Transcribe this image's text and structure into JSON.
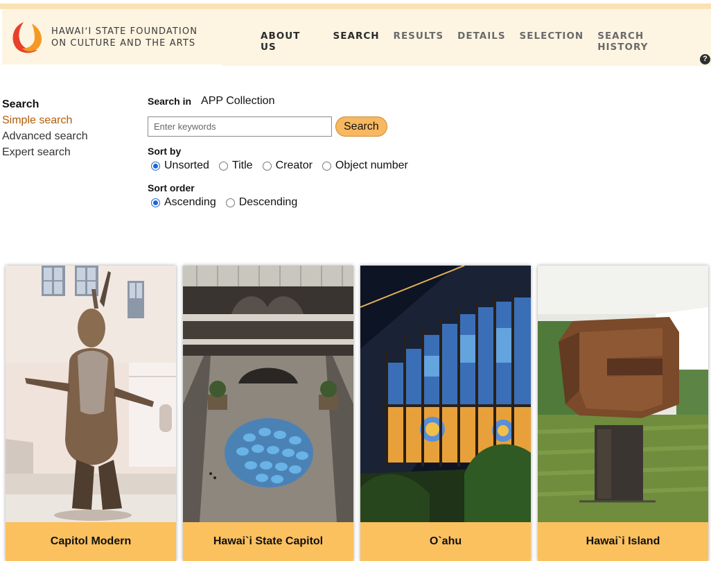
{
  "header": {
    "logo_line1": "HAWAIʻI STATE FOUNDATION",
    "logo_line2": "ON CULTURE AND THE ARTS",
    "nav": [
      {
        "label": "ABOUT US"
      },
      {
        "label": "SEARCH"
      },
      {
        "label": "RESULTS"
      },
      {
        "label": "DETAILS"
      },
      {
        "label": "SELECTION"
      },
      {
        "label": "SEARCH HISTORY"
      }
    ],
    "help_icon": "?"
  },
  "sidebar": {
    "heading": "Search",
    "links": [
      {
        "label": "Simple search"
      },
      {
        "label": "Advanced search"
      },
      {
        "label": "Expert search"
      }
    ]
  },
  "form": {
    "search_in_label": "Search in",
    "collection": "APP Collection",
    "keywords_placeholder": "Enter keywords",
    "keywords_value": "",
    "search_button": "Search",
    "sort_by_label": "Sort by",
    "sort_by_options": [
      "Unsorted",
      "Title",
      "Creator",
      "Object number"
    ],
    "sort_by_selected": "Unsorted",
    "sort_order_label": "Sort order",
    "sort_order_options": [
      "Ascending",
      "Descending"
    ],
    "sort_order_selected": "Ascending"
  },
  "cards": [
    {
      "caption": "Capitol Modern"
    },
    {
      "caption": "Hawai`i State Capitol"
    },
    {
      "caption": "O`ahu"
    },
    {
      "caption": "Hawai`i Island"
    }
  ],
  "colors": {
    "accent": "#f8b861",
    "card_caption_bg": "#fbc15f",
    "header_bg": "#fdf4e2",
    "active_link": "#b25c06"
  }
}
